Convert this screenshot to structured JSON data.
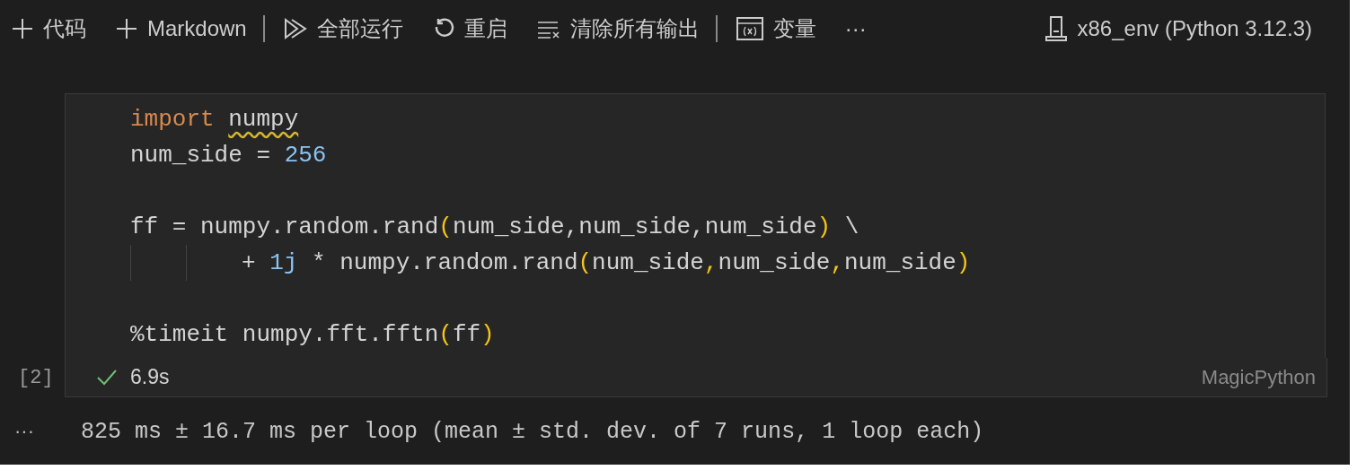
{
  "toolbar": {
    "items": [
      {
        "kind": "plus",
        "label": "代码"
      },
      {
        "kind": "plus",
        "label": "Markdown"
      },
      {
        "kind": "separator"
      },
      {
        "kind": "run-all",
        "label": "全部运行"
      },
      {
        "kind": "restart",
        "label": "重启"
      },
      {
        "kind": "clear",
        "label": "清除所有输出"
      },
      {
        "kind": "separator"
      },
      {
        "kind": "variables",
        "label": "变量"
      },
      {
        "kind": "more",
        "label": "···"
      }
    ],
    "kernel": "x86_env (Python 3.12.3)"
  },
  "cell": {
    "lines": [
      {
        "kind": "code",
        "tokens": [
          {
            "kind": "keyword",
            "text": "import "
          },
          {
            "kind": "warned",
            "text": "numpy"
          }
        ]
      },
      {
        "kind": "code",
        "tokens": [
          {
            "kind": "text",
            "text": "num_side = "
          },
          {
            "kind": "number",
            "text": "256"
          }
        ]
      },
      {
        "kind": "blank"
      },
      {
        "kind": "code",
        "tokens": [
          {
            "kind": "text",
            "text": "ff = numpy.random.rand"
          },
          {
            "kind": "bracket",
            "text": "("
          },
          {
            "kind": "text",
            "text": "num_side,num_side,num_side"
          },
          {
            "kind": "bracket",
            "text": ")"
          },
          {
            "kind": "text",
            "text": " \\"
          }
        ]
      },
      {
        "kind": "continued",
        "tokens": [
          {
            "kind": "text",
            "text": "+ "
          },
          {
            "kind": "number",
            "text": "1j"
          },
          {
            "kind": "text",
            "text": " * numpy.random.rand"
          },
          {
            "kind": "bracket",
            "text": "("
          },
          {
            "kind": "text",
            "text": "num_side"
          },
          {
            "kind": "bracket",
            "text": ","
          },
          {
            "kind": "text",
            "text": "num_side"
          },
          {
            "kind": "bracket",
            "text": ","
          },
          {
            "kind": "text",
            "text": "num_side"
          },
          {
            "kind": "bracket",
            "text": ")"
          }
        ]
      },
      {
        "kind": "blank"
      },
      {
        "kind": "code",
        "tokens": [
          {
            "kind": "text",
            "text": "%timeit numpy.fft.fftn"
          },
          {
            "kind": "bracket",
            "text": "("
          },
          {
            "kind": "text",
            "text": "ff"
          },
          {
            "kind": "bracket",
            "text": ")"
          }
        ]
      }
    ],
    "execution_count": "[2]",
    "success": true,
    "duration": "6.9s",
    "language": "MagicPython"
  },
  "output": {
    "menu": "···",
    "text": "825 ms ± 16.7 ms per loop (mean ± std. dev. of 7 runs, 1 loop each)"
  }
}
